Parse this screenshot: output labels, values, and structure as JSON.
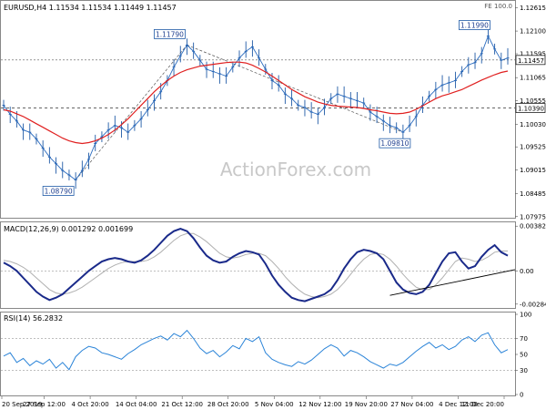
{
  "chart_data": {
    "type": "line",
    "source_watermark": "ActionForex.com",
    "x_ticks": [
      "20 Sep 2019",
      "27 Sep 12:00",
      "4 Oct 20:00",
      "14 Oct 04:00",
      "21 Oct 12:00",
      "28 Oct 20:00",
      "5 Nov 04:00",
      "12 Nov 12:00",
      "19 Nov 20:00",
      "27 Nov 04:00",
      "4 Dec 12:00",
      "11 Dec 20:00"
    ],
    "price_panel": {
      "header": "EURUSD,H4  1.11534 1.11534 1.11449 1.11457",
      "top_right_label": "FE 100.0",
      "y_ticks": [
        "1.12615",
        "1.12100",
        "1.11595",
        "1.11065",
        "1.10555",
        "1.10030",
        "1.09525",
        "1.09015",
        "1.08485",
        "1.07975"
      ],
      "ylim": [
        1.0797,
        1.1275
      ],
      "current_price": "1.11457",
      "support_level": "1.10390",
      "annotations": [
        "1.08790",
        "1.11790",
        "1.09810",
        "1.11990"
      ],
      "series": [
        {
          "kind": "price",
          "values": [
            1.1045,
            1.1025,
            1.101,
            1.099,
            1.0985,
            1.097,
            1.095,
            1.093,
            1.0915,
            1.09,
            1.089,
            1.0879,
            1.09,
            1.0925,
            1.096,
            1.0975,
            1.099,
            1.1,
            1.0995,
            1.0985,
            1.1,
            1.1015,
            1.1035,
            1.1055,
            1.1075,
            1.11,
            1.113,
            1.1155,
            1.1179,
            1.1165,
            1.1145,
            1.1125,
            1.112,
            1.1115,
            1.111,
            1.113,
            1.115,
            1.1165,
            1.1175,
            1.115,
            1.1125,
            1.11,
            1.109,
            1.107,
            1.106,
            1.1045,
            1.104,
            1.103,
            1.1025,
            1.104,
            1.106,
            1.107,
            1.1065,
            1.106,
            1.1055,
            1.105,
            1.103,
            1.102,
            1.101,
            1.1,
            1.0995,
            1.0985,
            1.1,
            1.102,
            1.1045,
            1.1065,
            1.108,
            1.109,
            1.1095,
            1.11,
            1.112,
            1.1135,
            1.114,
            1.116,
            1.1199,
            1.117,
            1.1145,
            1.115
          ]
        },
        {
          "kind": "moving_average",
          "values": [
            1.1035,
            1.1032,
            1.1026,
            1.102,
            1.1012,
            1.1004,
            1.0996,
            1.0988,
            1.098,
            1.0972,
            1.0966,
            1.0962,
            1.096,
            1.0962,
            1.0966,
            1.0972,
            1.098,
            1.099,
            1.1002,
            1.1015,
            1.103,
            1.1045,
            1.106,
            1.1075,
            1.1088,
            1.11,
            1.111,
            1.1118,
            1.1124,
            1.1128,
            1.1132,
            1.1134,
            1.1136,
            1.1138,
            1.114,
            1.1141,
            1.1141,
            1.1139,
            1.1134,
            1.1127,
            1.1119,
            1.111,
            1.11,
            1.109,
            1.108,
            1.1072,
            1.1064,
            1.1058,
            1.1052,
            1.1048,
            1.1045,
            1.1043,
            1.1042,
            1.1041,
            1.104,
            1.1038,
            1.1035,
            1.1033,
            1.103,
            1.1027,
            1.1026,
            1.1027,
            1.103,
            1.1036,
            1.1044,
            1.1052,
            1.106,
            1.1066,
            1.107,
            1.1075,
            1.108,
            1.1087,
            1.1094,
            1.1101,
            1.1107,
            1.1113,
            1.1118,
            1.1121
          ]
        }
      ]
    },
    "macd_panel": {
      "header": "MACD(12,26,9) 0.001292 0.001699",
      "y_ticks": [
        "0.003826",
        "0.00",
        "-0.002849"
      ],
      "ylim": [
        -0.0031,
        0.004
      ],
      "series": [
        {
          "kind": "macd",
          "values": [
            0.0007,
            0.0004,
            0.0,
            -0.0006,
            -0.0012,
            -0.0018,
            -0.0022,
            -0.0025,
            -0.0023,
            -0.002,
            -0.0015,
            -0.001,
            -0.0005,
            0.0,
            0.0004,
            0.0008,
            0.001,
            0.0011,
            0.001,
            0.0008,
            0.0007,
            0.0009,
            0.0013,
            0.0018,
            0.0024,
            0.003,
            0.0034,
            0.0036,
            0.0034,
            0.0028,
            0.002,
            0.0013,
            0.0009,
            0.0007,
            0.0008,
            0.0012,
            0.0015,
            0.0017,
            0.0016,
            0.0014,
            0.0006,
            -0.0004,
            -0.0012,
            -0.0018,
            -0.0023,
            -0.0025,
            -0.0026,
            -0.0024,
            -0.0022,
            -0.002,
            -0.0016,
            -0.0008,
            0.0002,
            0.001,
            0.0016,
            0.0018,
            0.0017,
            0.0015,
            0.001,
            0.0,
            -0.001,
            -0.0016,
            -0.0019,
            -0.002,
            -0.0018,
            -0.0012,
            -0.0002,
            0.0008,
            0.0015,
            0.0016,
            0.0008,
            0.0002,
            0.0004,
            0.0012,
            0.0018,
            0.0022,
            0.0016,
            0.0013
          ]
        },
        {
          "kind": "signal",
          "values": [
            0.0009,
            0.0008,
            0.0006,
            0.0003,
            -0.0001,
            -0.0006,
            -0.0011,
            -0.0016,
            -0.0019,
            -0.002,
            -0.0019,
            -0.0017,
            -0.0014,
            -0.001,
            -0.0006,
            -0.0002,
            0.0002,
            0.0005,
            0.0007,
            0.0008,
            0.0008,
            0.0008,
            0.0009,
            0.0012,
            0.0016,
            0.0021,
            0.0026,
            0.003,
            0.0032,
            0.0032,
            0.0029,
            0.0025,
            0.002,
            0.0015,
            0.0012,
            0.0011,
            0.0012,
            0.0014,
            0.0015,
            0.0015,
            0.0013,
            0.0008,
            0.0002,
            -0.0005,
            -0.0011,
            -0.0016,
            -0.002,
            -0.0022,
            -0.0023,
            -0.0022,
            -0.002,
            -0.0016,
            -0.001,
            -0.0003,
            0.0004,
            0.001,
            0.0014,
            0.0015,
            0.0014,
            0.001,
            0.0004,
            -0.0003,
            -0.0009,
            -0.0014,
            -0.0016,
            -0.0016,
            -0.0012,
            -0.0006,
            0.0001,
            0.0008,
            0.0011,
            0.001,
            0.0008,
            0.0009,
            0.0012,
            0.0016,
            0.0017,
            0.0017
          ]
        }
      ]
    },
    "rsi_panel": {
      "header": "RSI(14) 56.2832",
      "y_ticks": [
        "100",
        "70",
        "50",
        "30",
        "0"
      ],
      "ylim": [
        0,
        100
      ],
      "series": [
        {
          "kind": "rsi",
          "values": [
            48,
            52,
            40,
            45,
            36,
            42,
            38,
            44,
            33,
            40,
            31,
            47,
            55,
            60,
            58,
            52,
            50,
            47,
            44,
            51,
            56,
            62,
            66,
            70,
            73,
            68,
            76,
            72,
            80,
            70,
            58,
            51,
            55,
            47,
            53,
            61,
            57,
            70,
            66,
            72,
            52,
            44,
            40,
            37,
            35,
            41,
            38,
            43,
            50,
            57,
            62,
            58,
            48,
            55,
            52,
            47,
            41,
            37,
            33,
            38,
            36,
            40,
            47,
            54,
            60,
            65,
            58,
            62,
            56,
            60,
            68,
            72,
            66,
            74,
            77,
            62,
            52,
            56
          ]
        }
      ]
    }
  }
}
